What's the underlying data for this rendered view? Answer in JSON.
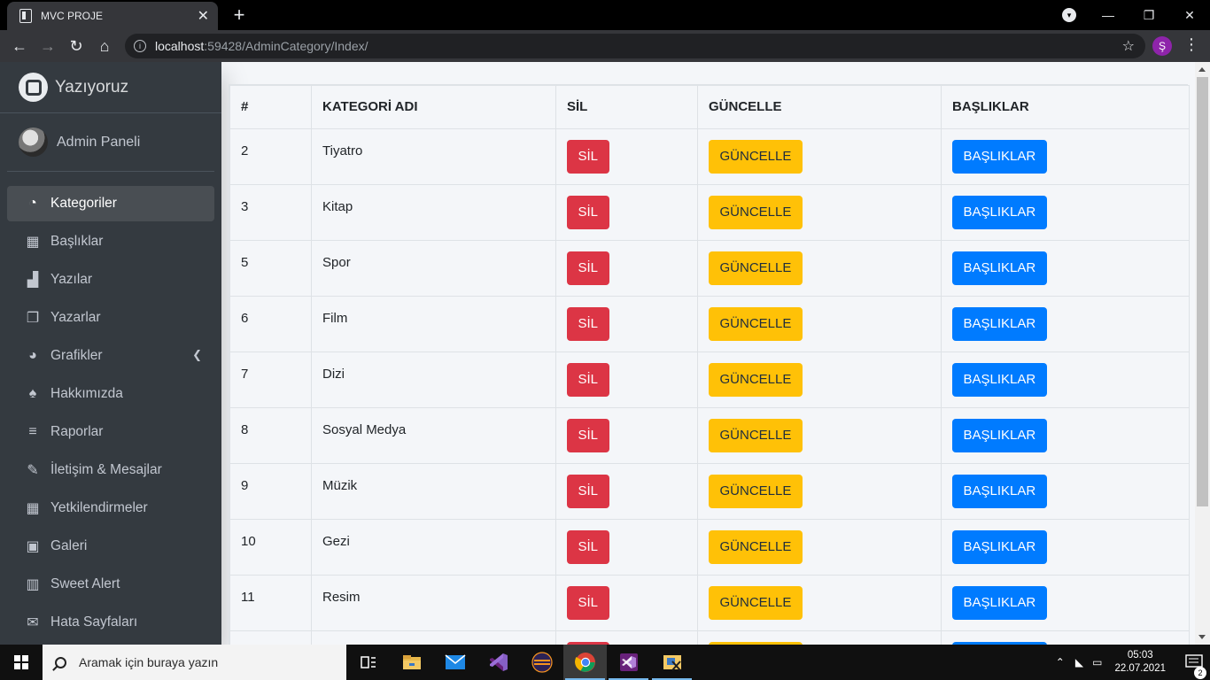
{
  "browser": {
    "tab_title": "MVC PROJE",
    "tab_close": "✕",
    "new_tab": "+",
    "url_host": "localhost",
    "url_path": ":59428/AdminCategory/Index/",
    "profile_initial": "Ş",
    "window_controls": {
      "minimize": "—",
      "restore": "❐",
      "close": "✕"
    }
  },
  "sidebar": {
    "brand": "Yazıyoruz",
    "user": "Admin Paneli",
    "items": [
      {
        "label": "Kategoriler",
        "icon": "dashboard-icon",
        "glyph": "◔",
        "active": true
      },
      {
        "label": "Başlıklar",
        "icon": "grid-icon",
        "glyph": "▦"
      },
      {
        "label": "Yazılar",
        "icon": "writer-icon",
        "glyph": "▟"
      },
      {
        "label": "Yazarlar",
        "icon": "copy-icon",
        "glyph": "❐"
      },
      {
        "label": "Grafikler",
        "icon": "pie-chart-icon",
        "glyph": "◕",
        "caret": "❮"
      },
      {
        "label": "Hakkımızda",
        "icon": "tree-icon",
        "glyph": "♠"
      },
      {
        "label": "Raporlar",
        "icon": "bars-icon",
        "glyph": "≡"
      },
      {
        "label": "İletişim & Mesajlar",
        "icon": "edit-icon",
        "glyph": "✎"
      },
      {
        "label": "Yetkilendirmeler",
        "icon": "calendar-icon",
        "glyph": "▦"
      },
      {
        "label": "Galeri",
        "icon": "image-icon",
        "glyph": "▣"
      },
      {
        "label": "Sweet Alert",
        "icon": "map-icon",
        "glyph": "▥"
      },
      {
        "label": "Hata Sayfaları",
        "icon": "envelope-icon",
        "glyph": "✉"
      }
    ]
  },
  "table": {
    "headers": [
      "#",
      "KATEGORİ ADI",
      "SİL",
      "GÜNCELLE",
      "BAŞLIKLAR"
    ],
    "rows": [
      {
        "id": "2",
        "name": "Tiyatro"
      },
      {
        "id": "3",
        "name": "Kitap"
      },
      {
        "id": "5",
        "name": "Spor"
      },
      {
        "id": "6",
        "name": "Film"
      },
      {
        "id": "7",
        "name": "Dizi"
      },
      {
        "id": "8",
        "name": "Sosyal Medya"
      },
      {
        "id": "9",
        "name": "Müzik"
      },
      {
        "id": "10",
        "name": "Gezi"
      },
      {
        "id": "11",
        "name": "Resim"
      },
      {
        "id": "",
        "name": ""
      }
    ],
    "buttons": {
      "delete": "SİL",
      "update": "GÜNCELLE",
      "titles": "BAŞLIKLAR"
    },
    "colors": {
      "delete": "#dc3545",
      "update": "#ffc107",
      "titles": "#007bff"
    }
  },
  "taskbar": {
    "search_placeholder": "Aramak için buraya yazın",
    "time": "05:03",
    "date": "22.07.2021",
    "notification_count": "2"
  }
}
